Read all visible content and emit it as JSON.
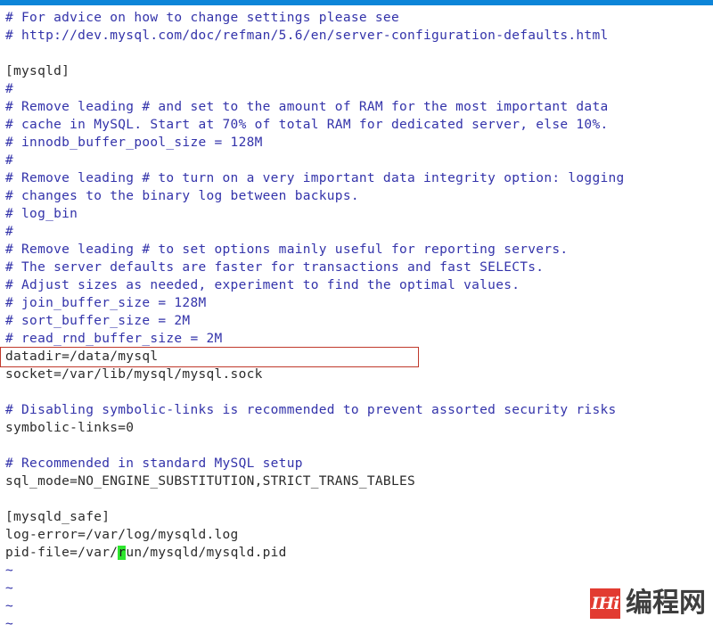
{
  "window": {
    "top_bar_color": "#0d85d8",
    "background_color": "#ffffff"
  },
  "editor": {
    "app": "vim",
    "filename_hint": "my.cnf",
    "comment_color": "#3333aa",
    "text_color": "#2b2b2b",
    "annotation_box_color": "#c0392b",
    "cursor_color": "#2ee62e",
    "lines": [
      {
        "text": "# For advice on how to change settings please see",
        "kind": "comment"
      },
      {
        "text": "# http://dev.mysql.com/doc/refman/5.6/en/server-configuration-defaults.html",
        "kind": "comment"
      },
      {
        "text": "",
        "kind": "blank"
      },
      {
        "text": "[mysqld]",
        "kind": "text"
      },
      {
        "text": "#",
        "kind": "comment"
      },
      {
        "text": "# Remove leading # and set to the amount of RAM for the most important data",
        "kind": "comment"
      },
      {
        "text": "# cache in MySQL. Start at 70% of total RAM for dedicated server, else 10%.",
        "kind": "comment"
      },
      {
        "text": "# innodb_buffer_pool_size = 128M",
        "kind": "comment"
      },
      {
        "text": "#",
        "kind": "comment"
      },
      {
        "text": "# Remove leading # to turn on a very important data integrity option: logging",
        "kind": "comment"
      },
      {
        "text": "# changes to the binary log between backups.",
        "kind": "comment"
      },
      {
        "text": "# log_bin",
        "kind": "comment"
      },
      {
        "text": "#",
        "kind": "comment"
      },
      {
        "text": "# Remove leading # to set options mainly useful for reporting servers.",
        "kind": "comment"
      },
      {
        "text": "# The server defaults are faster for transactions and fast SELECTs.",
        "kind": "comment"
      },
      {
        "text": "# Adjust sizes as needed, experiment to find the optimal values.",
        "kind": "comment"
      },
      {
        "text": "# join_buffer_size = 128M",
        "kind": "comment"
      },
      {
        "text": "# sort_buffer_size = 2M",
        "kind": "comment"
      },
      {
        "text": "# read_rnd_buffer_size = 2M",
        "kind": "comment"
      },
      {
        "text": "datadir=/data/mysql",
        "kind": "text",
        "boxed": true
      },
      {
        "text": "socket=/var/lib/mysql/mysql.sock",
        "kind": "text"
      },
      {
        "text": "",
        "kind": "blank"
      },
      {
        "text": "# Disabling symbolic-links is recommended to prevent assorted security risks",
        "kind": "comment"
      },
      {
        "text": "symbolic-links=0",
        "kind": "text"
      },
      {
        "text": "",
        "kind": "blank"
      },
      {
        "text": "# Recommended in standard MySQL setup",
        "kind": "comment"
      },
      {
        "text": "sql_mode=NO_ENGINE_SUBSTITUTION,STRICT_TRANS_TABLES",
        "kind": "text"
      },
      {
        "text": "",
        "kind": "blank"
      },
      {
        "text": "[mysqld_safe]",
        "kind": "text"
      },
      {
        "text": "log-error=/var/log/mysqld.log",
        "kind": "text"
      },
      {
        "text": "pid-file=/var/run/mysqld/mysqld.pid",
        "kind": "text",
        "cursor_index": 14
      },
      {
        "text": "~",
        "kind": "tilde"
      },
      {
        "text": "~",
        "kind": "tilde"
      },
      {
        "text": "~",
        "kind": "tilde"
      },
      {
        "text": "~",
        "kind": "tilde"
      }
    ]
  },
  "watermark": {
    "logo_text": "IHi",
    "label": "编程网",
    "sub_label": "",
    "logo_bg": "#e02b20"
  }
}
